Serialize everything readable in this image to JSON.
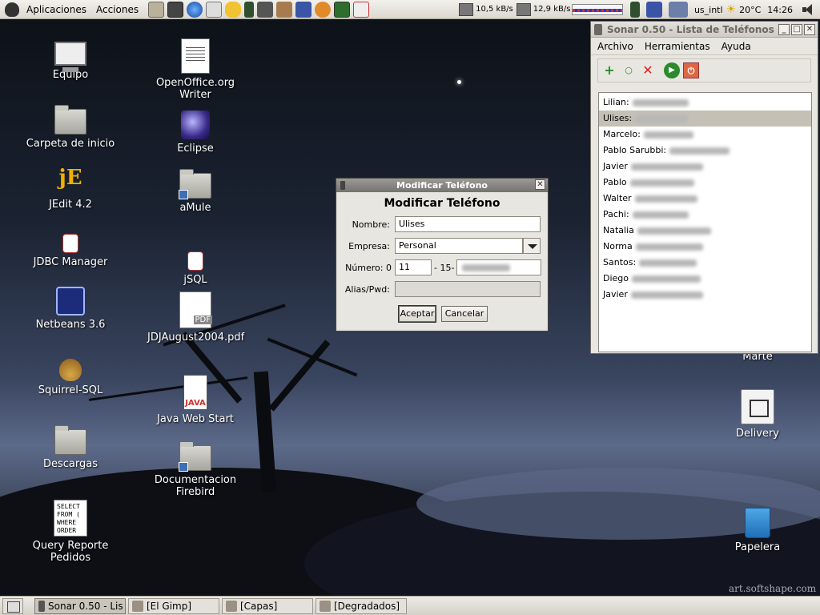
{
  "top_panel": {
    "menu": [
      "Aplicaciones",
      "Acciones"
    ],
    "net_down": "10,5 kB/s",
    "net_up": "12,9 kB/s",
    "keyboard_layout": "us_intl",
    "weather": "20°C",
    "clock": "14:26"
  },
  "desktop_icons": {
    "equipo": "Equipo",
    "carpeta": "Carpeta de inicio",
    "jedit": "JEdit 4.2",
    "jdbc": "JDBC Manager",
    "netbeans": "Netbeans 3.6",
    "squirrel": "Squirrel-SQL",
    "descargas": "Descargas",
    "query_line1": "Query Reporte",
    "query_line2": "Pedidos",
    "writer": "OpenOffice.org Writer",
    "eclipse": "Eclipse",
    "amule": "aMule",
    "jsql": "jSQL",
    "jdj": "JDJAugust2004.pdf",
    "javaws": "Java Web Start",
    "doc_line1": "Documentacion",
    "doc_line2": "Firebird",
    "delivery": "Delivery",
    "papelera": "Papelera",
    "marte": "Marte",
    "sql_doc_text": [
      "SELECT",
      "FROM (",
      "WHERE",
      "ORDER"
    ],
    "jedit_glyph": "jE",
    "java_glyph": "JAVA"
  },
  "sonar": {
    "title": "Sonar 0.50 - Lista de Teléfonos",
    "menus": [
      "Archivo",
      "Herramientas",
      "Ayuda"
    ],
    "tools": [
      "+",
      "○",
      "✕",
      "▶",
      "⏻"
    ],
    "contacts": [
      {
        "name": "Lilian:",
        "selected": false
      },
      {
        "name": "Ulises:",
        "selected": true
      },
      {
        "name": "Marcelo:",
        "selected": false
      },
      {
        "name": "Pablo Sarubbi:",
        "selected": false
      },
      {
        "name": "Javier",
        "selected": false
      },
      {
        "name": "Pablo",
        "selected": false
      },
      {
        "name": "Walter",
        "selected": false
      },
      {
        "name": "Pachi:",
        "selected": false
      },
      {
        "name": "Natalia",
        "selected": false
      },
      {
        "name": "Norma",
        "selected": false
      },
      {
        "name": "Santos:",
        "selected": false
      },
      {
        "name": "Diego",
        "selected": false
      },
      {
        "name": "Javier",
        "selected": false
      }
    ]
  },
  "dialog": {
    "title": "Modificar Teléfono",
    "heading": "Modificar Teléfono",
    "nombre_label": "Nombre:",
    "nombre_value": "Ulises",
    "empresa_label": "Empresa:",
    "empresa_value": "Personal",
    "numero_label": "Número: 0",
    "area_code": "11",
    "separator": "- 15-",
    "alias_label": "Alias/Pwd:",
    "alias_value": "",
    "accept_label": "Aceptar",
    "cancel_label": "Cancelar"
  },
  "taskbar": {
    "tasks": [
      "Sonar 0.50 - Lis",
      "[El Gimp]",
      "[Capas]",
      "[Degradados]"
    ]
  },
  "watermark": "art.softshape.com",
  "colors": {
    "accent": "#6e6e6e",
    "selection": "#c4c0b6"
  }
}
